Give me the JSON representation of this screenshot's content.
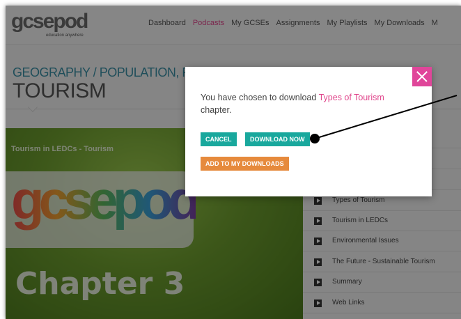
{
  "header": {
    "logo_text": "gcsepod",
    "logo_tagline": "education anywhere",
    "nav": [
      {
        "label": "Dashboard",
        "active": false
      },
      {
        "label": "Podcasts",
        "active": true
      },
      {
        "label": "My GCSEs",
        "active": false
      },
      {
        "label": "Assignments",
        "active": false
      },
      {
        "label": "My Playlists",
        "active": false
      },
      {
        "label": "My Downloads",
        "active": false
      },
      {
        "label": "M",
        "active": false
      }
    ]
  },
  "page": {
    "breadcrumb": "GEOGRAPHY / POPULATION, RE",
    "title": "TOURISM"
  },
  "video": {
    "title": "Tourism in LEDCs - Tourism",
    "logo_text": "gcsepod",
    "chapter_label": "Chapter 3"
  },
  "chapters": [
    {
      "label": "Types of Tourism"
    },
    {
      "label": "Tourism in LEDCs"
    },
    {
      "label": "Environmental Issues"
    },
    {
      "label": "The Future - Sustainable Tourism"
    },
    {
      "label": "Summary"
    },
    {
      "label": "Web Links"
    }
  ],
  "modal": {
    "message_prefix": "You have chosen to download ",
    "message_highlight": "Types of Tourism",
    "message_suffix": "chapter.",
    "cancel_label": "CANCEL",
    "download_label": "DOWNLOAD NOW",
    "add_label": "ADD TO MY DOWNLOADS"
  },
  "colors": {
    "accent_pink": "#e0468c",
    "teal_button": "#19a89d",
    "orange_button": "#e68a3c",
    "breadcrumb_blue": "#3a8fa5"
  }
}
